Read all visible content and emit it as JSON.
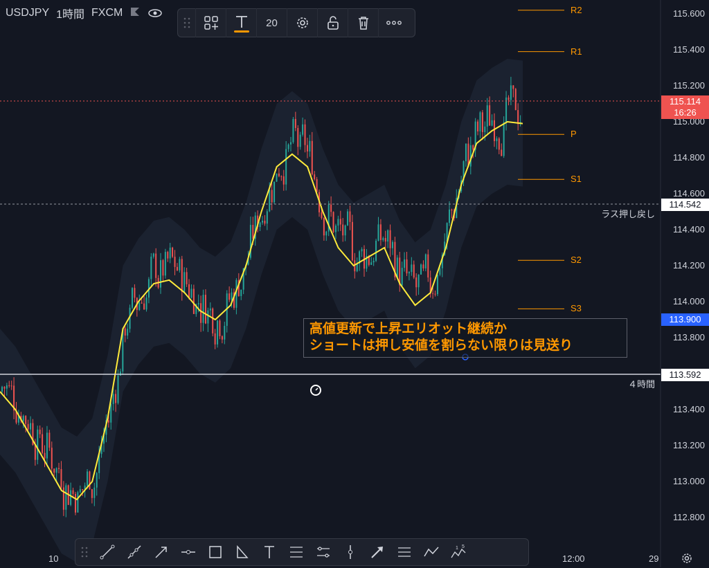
{
  "symbol": {
    "name": "USDJPY",
    "interval": "1時間",
    "exchange": "FXCM"
  },
  "text_toolbar": {
    "font_size": "20"
  },
  "colors": {
    "bg": "#131722",
    "up": "#26a69a",
    "down": "#ef5350",
    "ma": "#ffeb3b",
    "pivot": "#ff9800",
    "band": "#1b2230"
  },
  "chart_data": {
    "type": "candlestick",
    "y_axis": {
      "ticks": [
        "115.600",
        "115.400",
        "115.200",
        "115.000",
        "114.800",
        "114.600",
        "114.400",
        "114.200",
        "114.000",
        "113.800",
        "113.600",
        "113.400",
        "113.200",
        "113.000",
        "112.800"
      ],
      "range": [
        112.66,
        115.7
      ]
    },
    "x_axis": {
      "ticks": [
        "10",
        "12:00",
        "29"
      ]
    },
    "current_price": {
      "value": "115.114",
      "countdown": "16:26"
    },
    "horizontal_lines": [
      {
        "price": "114.542",
        "label": "ラス押し戻し",
        "style": "dashed"
      },
      {
        "price": "113.592",
        "label": "４時間",
        "style": "solid"
      }
    ],
    "highlight_price": "113.900",
    "pivots": [
      {
        "name": "R2",
        "price": 115.62
      },
      {
        "name": "R1",
        "price": 115.39
      },
      {
        "name": "P",
        "price": 114.93
      },
      {
        "name": "S1",
        "price": 114.68
      },
      {
        "name": "S2",
        "price": 114.23
      },
      {
        "name": "S3",
        "price": 113.96
      }
    ],
    "ma_path_prices": [
      113.5,
      113.4,
      113.25,
      113.1,
      112.95,
      112.9,
      113.0,
      113.35,
      113.85,
      114.0,
      114.1,
      114.12,
      114.05,
      113.95,
      113.9,
      113.98,
      114.2,
      114.5,
      114.75,
      114.82,
      114.75,
      114.5,
      114.3,
      114.2,
      114.25,
      114.3,
      114.1,
      113.98,
      114.05,
      114.3,
      114.65,
      114.88,
      114.95,
      115.0,
      114.99
    ],
    "annotation": {
      "line1": "高値更新で上昇エリオット継続か",
      "line2": "ショートは押し安値を割らない限りは見送り"
    }
  },
  "tool_names": [
    "trend-line",
    "ray",
    "arrow",
    "horizontal-ray",
    "rectangle",
    "triangle",
    "text",
    "fib-retracement",
    "fib-channel",
    "vertical-line",
    "arrow-marker",
    "parallel-channel",
    "path",
    "elliott-wave"
  ]
}
